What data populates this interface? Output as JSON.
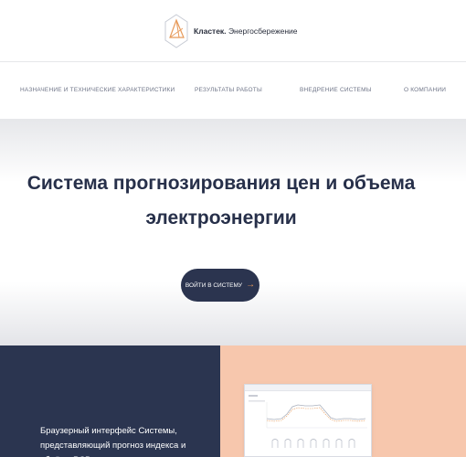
{
  "header": {
    "brand_name": "Кластек.",
    "brand_tagline": "Энергосбережение",
    "logo_icon": "polygon-logo-icon"
  },
  "nav": {
    "items": [
      {
        "label": "Назначение и технические характеристики"
      },
      {
        "label": "Результаты работы"
      },
      {
        "label": "Внедрение системы"
      },
      {
        "label": "О компании"
      }
    ]
  },
  "hero": {
    "title_line1": "Система прогнозирования цен и объема",
    "title_line2": "электроэнергии",
    "cta_label": "Войти в систему",
    "cta_icon": "arrow-right-icon"
  },
  "feature": {
    "text_line1": "Браузерный интерфейс Системы,",
    "text_line2": "представляющий прогноз индекса и объёма РСВ"
  },
  "colors": {
    "dark_navy": "#2b3550",
    "peach": "#f7c7ad",
    "accent_orange": "#e79a5a"
  }
}
